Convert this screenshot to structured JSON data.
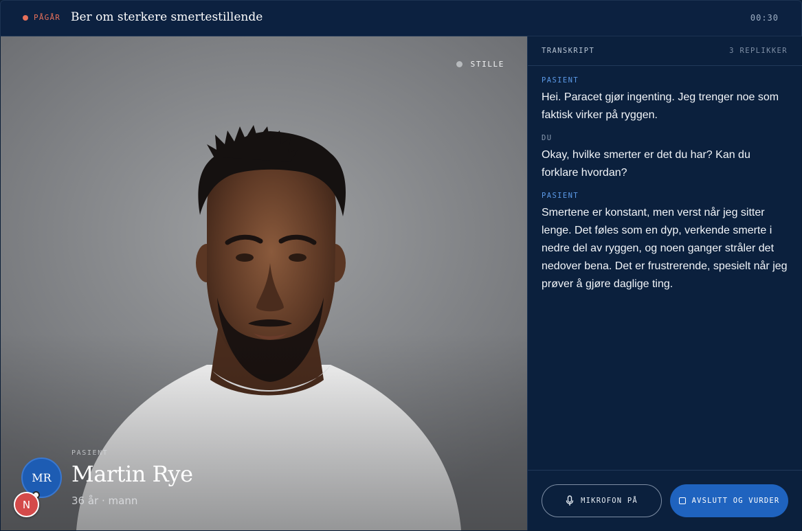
{
  "header": {
    "status_label": "PÅGÅR",
    "title": "Ber om sterkere smertestillende",
    "timer": "00:30"
  },
  "video": {
    "state_label": "STILLE",
    "patient": {
      "initials": "MR",
      "role_label": "PASIENT",
      "name": "Martin Rye",
      "meta": "36 år · mann"
    },
    "badge_letter": "N"
  },
  "transcript": {
    "title": "TRANSKRIPT",
    "count": "3 REPLIKKER",
    "messages": [
      {
        "speaker": "PASIENT",
        "text": "Hei. Paracet gjør ingenting. Jeg trenger noe som faktisk virker på ryggen."
      },
      {
        "speaker": "DU",
        "text": "Okay, hvilke smerter er det du har? Kan du forklare hvordan?"
      },
      {
        "speaker": "PASIENT",
        "text": "Smertene er konstant, men verst når jeg sitter lenge. Det føles som en dyp, verkende smerte i nedre del av ryggen, og noen ganger stråler det nedover bena. Det er frustrerende, spesielt når jeg prøver å gjøre daglige ting."
      }
    ]
  },
  "controls": {
    "mic_label": "MIKROFON PÅ",
    "end_label": "AVSLUTT OG VURDER"
  },
  "icons": {
    "mic": "microphone-icon",
    "end": "stop-square-icon"
  },
  "colors": {
    "accent": "#1f63bf",
    "live": "#e7705a",
    "background": "#0a1d36"
  }
}
